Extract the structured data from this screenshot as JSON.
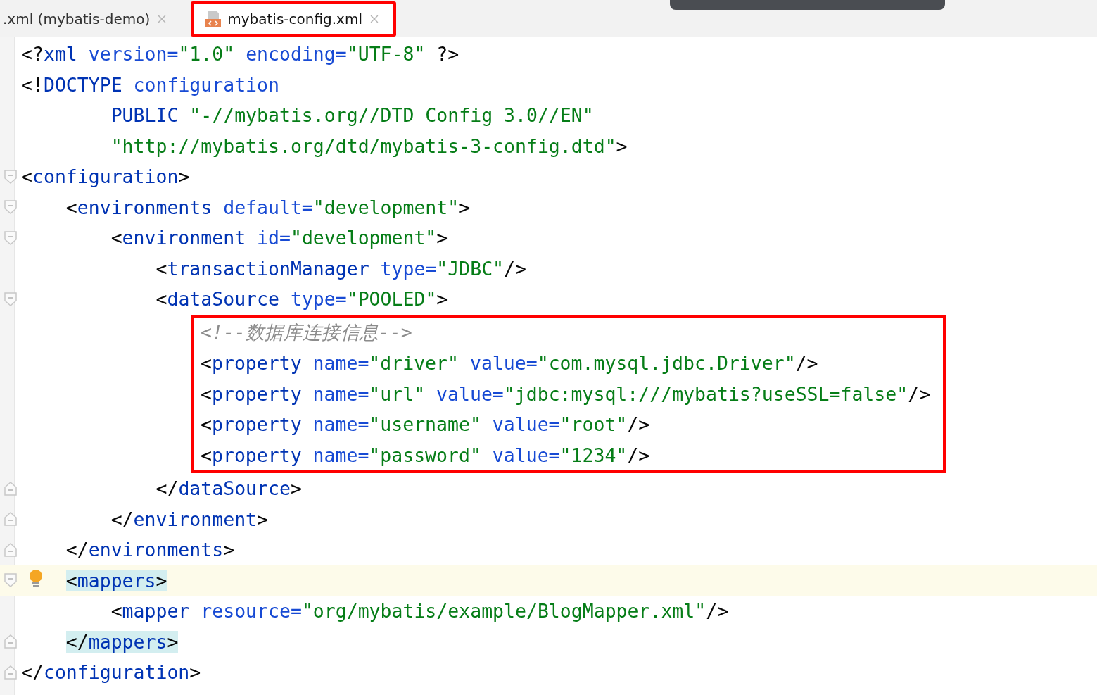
{
  "tabs": [
    {
      "label": ".xml (mybatis-demo)",
      "selected": false,
      "annotated": false,
      "file_icon": false
    },
    {
      "label": "mybatis-config.xml",
      "selected": true,
      "annotated": true,
      "file_icon": true
    }
  ],
  "editor": {
    "lines": [
      {
        "tokens": [
          {
            "kind": "p",
            "text": "<?"
          },
          {
            "kind": "tag",
            "text": "xml"
          },
          {
            "kind": "attr",
            "text": " version="
          },
          {
            "kind": "val",
            "text": "\"1.0\""
          },
          {
            "kind": "attr",
            "text": " encoding="
          },
          {
            "kind": "val",
            "text": "\"UTF-8\""
          },
          {
            "kind": "p",
            "text": " ?>"
          }
        ]
      },
      {
        "tokens": [
          {
            "kind": "p",
            "text": "<!"
          },
          {
            "kind": "tag",
            "text": "DOCTYPE"
          },
          {
            "kind": "attr",
            "text": " configuration"
          }
        ]
      },
      {
        "tokens": [
          {
            "kind": "tag",
            "text": "        PUBLIC"
          },
          {
            "kind": "val",
            "text": " \"-//mybatis.org//DTD Config 3.0//EN\""
          }
        ]
      },
      {
        "tokens": [
          {
            "kind": "val",
            "text": "        \"http://mybatis.org/dtd/mybatis-3-config.dtd\""
          },
          {
            "kind": "p",
            "text": ">"
          }
        ]
      },
      {
        "fold_open": true,
        "tokens": [
          {
            "kind": "p",
            "text": "<"
          },
          {
            "kind": "tag",
            "text": "configuration"
          },
          {
            "kind": "p",
            "text": ">"
          }
        ]
      },
      {
        "fold_open": true,
        "tokens": [
          {
            "kind": "p",
            "text": "    <"
          },
          {
            "kind": "tag",
            "text": "environments"
          },
          {
            "kind": "attr",
            "text": " default="
          },
          {
            "kind": "val",
            "text": "\"development\""
          },
          {
            "kind": "p",
            "text": ">"
          }
        ]
      },
      {
        "fold_open": true,
        "tokens": [
          {
            "kind": "p",
            "text": "        <"
          },
          {
            "kind": "tag",
            "text": "environment"
          },
          {
            "kind": "attr",
            "text": " id="
          },
          {
            "kind": "val",
            "text": "\"development\""
          },
          {
            "kind": "p",
            "text": ">"
          }
        ]
      },
      {
        "tokens": [
          {
            "kind": "p",
            "text": "            <"
          },
          {
            "kind": "tag",
            "text": "transactionManager"
          },
          {
            "kind": "attr",
            "text": " type="
          },
          {
            "kind": "val",
            "text": "\"JDBC\""
          },
          {
            "kind": "p",
            "text": "/>"
          }
        ]
      },
      {
        "fold_open": true,
        "tokens": [
          {
            "kind": "p",
            "text": "            <"
          },
          {
            "kind": "tag",
            "text": "dataSource"
          },
          {
            "kind": "attr",
            "text": " type="
          },
          {
            "kind": "val",
            "text": "\"POOLED\""
          },
          {
            "kind": "p",
            "text": ">"
          }
        ]
      },
      {
        "kind": "boxed",
        "lines": [
          {
            "tokens": [
              {
                "kind": "comment",
                "text": "<!--数据库连接信息-->"
              }
            ]
          },
          {
            "tokens": [
              {
                "kind": "p",
                "text": "<"
              },
              {
                "kind": "tag",
                "text": "property"
              },
              {
                "kind": "attr",
                "text": " name="
              },
              {
                "kind": "val",
                "text": "\"driver\""
              },
              {
                "kind": "attr",
                "text": " value="
              },
              {
                "kind": "val",
                "text": "\"com.mysql.jdbc.Driver\""
              },
              {
                "kind": "p",
                "text": "/>"
              }
            ]
          },
          {
            "tokens": [
              {
                "kind": "p",
                "text": "<"
              },
              {
                "kind": "tag",
                "text": "property"
              },
              {
                "kind": "attr",
                "text": " name="
              },
              {
                "kind": "val",
                "text": "\"url\""
              },
              {
                "kind": "attr",
                "text": " value="
              },
              {
                "kind": "val",
                "text": "\"jdbc:mysql:///mybatis?useSSL=false\""
              },
              {
                "kind": "p",
                "text": "/>"
              }
            ]
          },
          {
            "tokens": [
              {
                "kind": "p",
                "text": "<"
              },
              {
                "kind": "tag",
                "text": "property"
              },
              {
                "kind": "attr",
                "text": " name="
              },
              {
                "kind": "val",
                "text": "\"username\""
              },
              {
                "kind": "attr",
                "text": " value="
              },
              {
                "kind": "val",
                "text": "\"root\""
              },
              {
                "kind": "p",
                "text": "/>"
              }
            ]
          },
          {
            "tokens": [
              {
                "kind": "p",
                "text": "<"
              },
              {
                "kind": "tag",
                "text": "property"
              },
              {
                "kind": "attr",
                "text": " name="
              },
              {
                "kind": "val",
                "text": "\"password\""
              },
              {
                "kind": "attr",
                "text": " value="
              },
              {
                "kind": "val",
                "text": "\"1234\""
              },
              {
                "kind": "p",
                "text": "/>"
              }
            ]
          }
        ]
      },
      {
        "fold_close": true,
        "tokens": [
          {
            "kind": "p",
            "text": "            </"
          },
          {
            "kind": "tag",
            "text": "dataSource"
          },
          {
            "kind": "p",
            "text": ">"
          }
        ]
      },
      {
        "fold_close": true,
        "tokens": [
          {
            "kind": "p",
            "text": "        </"
          },
          {
            "kind": "tag",
            "text": "environment"
          },
          {
            "kind": "p",
            "text": ">"
          }
        ]
      },
      {
        "fold_close": true,
        "tokens": [
          {
            "kind": "p",
            "text": "    </"
          },
          {
            "kind": "tag",
            "text": "environments"
          },
          {
            "kind": "p",
            "text": ">"
          }
        ]
      },
      {
        "fold_open": true,
        "current": true,
        "bulb": true,
        "tokens": [
          {
            "kind": "p",
            "text": "    <",
            "matched": true
          },
          {
            "kind": "tag",
            "text": "mappers",
            "matched": true
          },
          {
            "kind": "p",
            "text": ">",
            "matched": true
          }
        ]
      },
      {
        "tokens": [
          {
            "kind": "p",
            "text": "        <"
          },
          {
            "kind": "tag",
            "text": "mapper"
          },
          {
            "kind": "attr",
            "text": " resource="
          },
          {
            "kind": "val",
            "text": "\"org/mybatis/example/BlogMapper.xml\""
          },
          {
            "kind": "p",
            "text": "/>"
          }
        ]
      },
      {
        "fold_close": true,
        "tokens": [
          {
            "kind": "p",
            "text": "    </",
            "matched": true
          },
          {
            "kind": "tag",
            "text": "mappers",
            "matched": true
          },
          {
            "kind": "p",
            "text": ">",
            "matched": true
          }
        ]
      },
      {
        "fold_close": true,
        "tokens": [
          {
            "kind": "p",
            "text": "</"
          },
          {
            "kind": "tag",
            "text": "configuration"
          },
          {
            "kind": "p",
            "text": ">"
          }
        ]
      }
    ]
  }
}
